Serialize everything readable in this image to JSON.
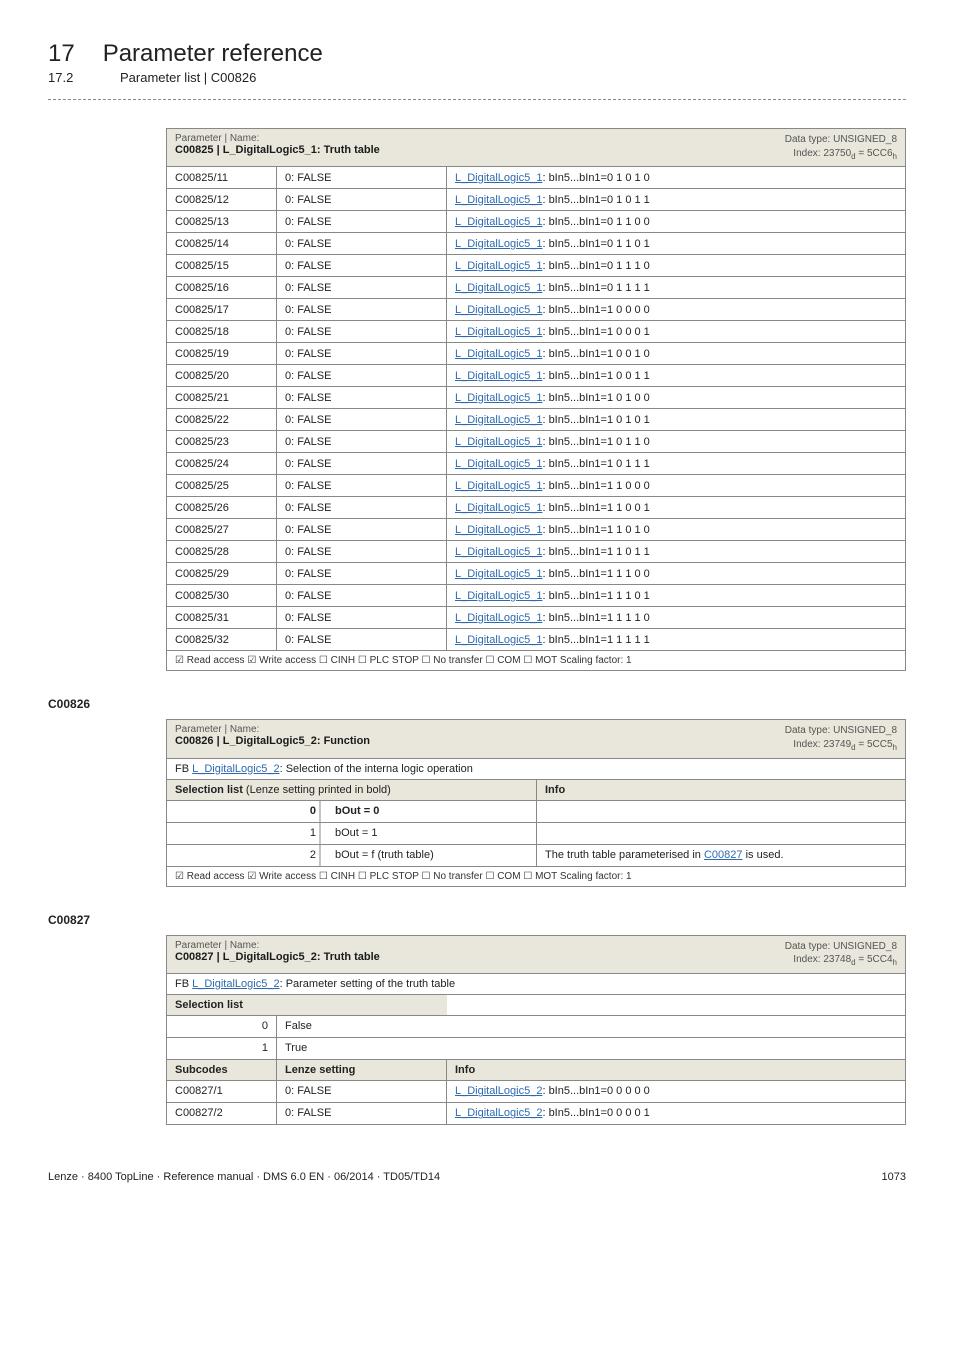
{
  "chapter": {
    "num": "17",
    "title": "Parameter reference"
  },
  "section": {
    "num": "17.2",
    "title": "Parameter list | C00826"
  },
  "table825": {
    "header": {
      "pn": "Parameter | Name:",
      "pt": "C00825 | L_DigitalLogic5_1: Truth table",
      "dt": "Data type: UNSIGNED_8",
      "idx_pre": "Index: 23750",
      "idx_sub1": "d",
      "idx_mid": " = 5CC6",
      "idx_sub2": "h"
    },
    "link_text": "L_DigitalLogic5_1",
    "rows": [
      {
        "code": "C00825/11",
        "val": "0: FALSE",
        "bits": "bIn5...bIn1=0 1 0 1 0"
      },
      {
        "code": "C00825/12",
        "val": "0: FALSE",
        "bits": "bIn5...bIn1=0 1 0 1 1"
      },
      {
        "code": "C00825/13",
        "val": "0: FALSE",
        "bits": "bIn5...bIn1=0 1 1 0 0"
      },
      {
        "code": "C00825/14",
        "val": "0: FALSE",
        "bits": "bIn5...bIn1=0 1 1 0 1"
      },
      {
        "code": "C00825/15",
        "val": "0: FALSE",
        "bits": "bIn5...bIn1=0 1 1 1 0"
      },
      {
        "code": "C00825/16",
        "val": "0: FALSE",
        "bits": "bIn5...bIn1=0 1 1 1 1"
      },
      {
        "code": "C00825/17",
        "val": "0: FALSE",
        "bits": "bIn5...bIn1=1 0 0 0 0"
      },
      {
        "code": "C00825/18",
        "val": "0: FALSE",
        "bits": "bIn5...bIn1=1 0 0 0 1"
      },
      {
        "code": "C00825/19",
        "val": "0: FALSE",
        "bits": "bIn5...bIn1=1 0 0 1 0"
      },
      {
        "code": "C00825/20",
        "val": "0: FALSE",
        "bits": "bIn5...bIn1=1 0 0 1 1"
      },
      {
        "code": "C00825/21",
        "val": "0: FALSE",
        "bits": "bIn5...bIn1=1 0 1 0 0"
      },
      {
        "code": "C00825/22",
        "val": "0: FALSE",
        "bits": "bIn5...bIn1=1 0 1 0 1"
      },
      {
        "code": "C00825/23",
        "val": "0: FALSE",
        "bits": "bIn5...bIn1=1 0 1 1 0"
      },
      {
        "code": "C00825/24",
        "val": "0: FALSE",
        "bits": "bIn5...bIn1=1 0 1 1 1"
      },
      {
        "code": "C00825/25",
        "val": "0: FALSE",
        "bits": "bIn5...bIn1=1 1 0 0 0"
      },
      {
        "code": "C00825/26",
        "val": "0: FALSE",
        "bits": "bIn5...bIn1=1 1 0 0 1"
      },
      {
        "code": "C00825/27",
        "val": "0: FALSE",
        "bits": "bIn5...bIn1=1 1 0 1 0"
      },
      {
        "code": "C00825/28",
        "val": "0: FALSE",
        "bits": "bIn5...bIn1=1 1 0 1 1"
      },
      {
        "code": "C00825/29",
        "val": "0: FALSE",
        "bits": "bIn5...bIn1=1 1 1 0 0"
      },
      {
        "code": "C00825/30",
        "val": "0: FALSE",
        "bits": "bIn5...bIn1=1 1 1 0 1"
      },
      {
        "code": "C00825/31",
        "val": "0: FALSE",
        "bits": "bIn5...bIn1=1 1 1 1 0"
      },
      {
        "code": "C00825/32",
        "val": "0: FALSE",
        "bits": "bIn5...bIn1=1 1 1 1 1"
      }
    ],
    "footer": "☑ Read access  ☑ Write access  ☐ CINH  ☐ PLC STOP  ☐ No transfer  ☐ COM  ☐ MOT   Scaling factor: 1"
  },
  "label826": "C00826",
  "table826": {
    "header": {
      "pn": "Parameter | Name:",
      "pt": "C00826 | L_DigitalLogic5_2: Function",
      "dt": "Data type: UNSIGNED_8",
      "idx_pre": "Index: 23749",
      "idx_sub1": "d",
      "idx_mid": " = 5CC5",
      "idx_sub2": "h"
    },
    "fb_pre": "FB ",
    "fb_link": "L_DigitalLogic5_2",
    "fb_post": ": Selection of the interna logic operation",
    "sel_label": "Selection list",
    "sel_note": " (Lenze setting printed in bold)",
    "info_label": "Info",
    "rows": [
      {
        "n": "0",
        "opt": "bOut = 0",
        "info": ""
      },
      {
        "n": "1",
        "opt": "bOut = 1",
        "info": ""
      },
      {
        "n": "2",
        "opt": "bOut = f (truth table)",
        "info_pre": "The truth table parameterised in ",
        "info_link": "C00827",
        "info_post": "  is used."
      }
    ],
    "footer": "☑ Read access  ☑ Write access  ☐ CINH  ☐ PLC STOP  ☐ No transfer  ☐ COM  ☐ MOT   Scaling factor: 1"
  },
  "label827": "C00827",
  "table827": {
    "header": {
      "pn": "Parameter | Name:",
      "pt": "C00827 | L_DigitalLogic5_2: Truth table",
      "dt": "Data type: UNSIGNED_8",
      "idx_pre": "Index: 23748",
      "idx_sub1": "d",
      "idx_mid": " = 5CC4",
      "idx_sub2": "h"
    },
    "fb_pre": "FB ",
    "fb_link": "L_DigitalLogic5_2",
    "fb_post": ": Parameter setting of the truth table",
    "sel_label": "Selection list",
    "rows_sel": [
      {
        "n": "0",
        "opt": "False"
      },
      {
        "n": "1",
        "opt": "True"
      }
    ],
    "sub_label": "Subcodes",
    "lenze_label": "Lenze setting",
    "info_label": "Info",
    "link_text": "L_DigitalLogic5_2",
    "rows_sub": [
      {
        "code": "C00827/1",
        "val": "0: FALSE",
        "bits": "bIn5...bIn1=0 0 0 0 0"
      },
      {
        "code": "C00827/2",
        "val": "0: FALSE",
        "bits": "bIn5...bIn1=0 0 0 0 1"
      }
    ]
  },
  "footer": {
    "left": "Lenze · 8400 TopLine · Reference manual · DMS 6.0 EN · 06/2014 · TD05/TD14",
    "right": "1073"
  }
}
